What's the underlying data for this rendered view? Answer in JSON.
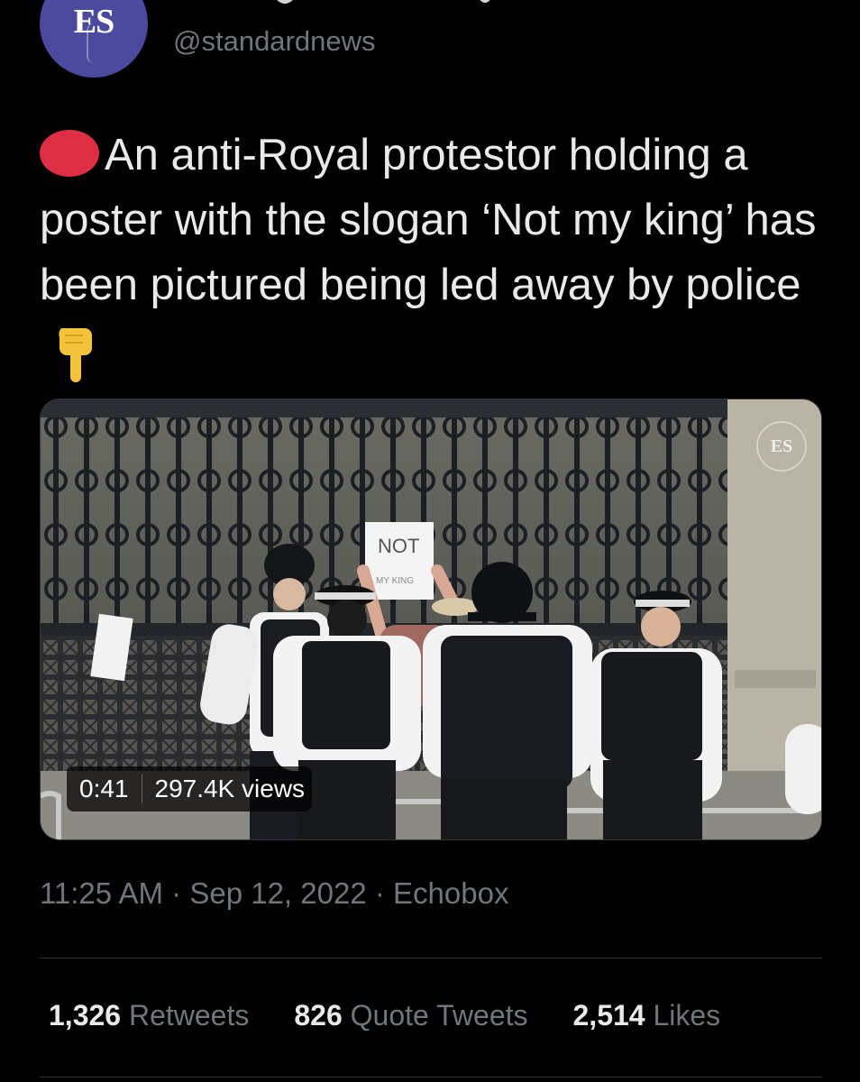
{
  "account": {
    "avatar_text": "ES",
    "handle": "@standardnews"
  },
  "tweet": {
    "text": "An anti-Royal protestor holding a poster with the slogan ‘Not my king’ has been pictured being led away by police",
    "leading_emoji": "red-circle-icon",
    "trailing_emoji": "point-down-icon"
  },
  "media": {
    "type": "video",
    "duration": "0:41",
    "views": "297.4K views",
    "watermark": "ES",
    "sign_text": "NOT",
    "sign_subtext": "MY KING"
  },
  "meta": {
    "time": "11:25 AM",
    "date": "Sep 12, 2022",
    "source": "Echobox",
    "separator": "·"
  },
  "stats": {
    "retweets_count": "1,326",
    "retweets_label": "Retweets",
    "quotes_count": "826",
    "quotes_label": "Quote Tweets",
    "likes_count": "2,514",
    "likes_label": "Likes"
  },
  "colors": {
    "background": "#000000",
    "text": "#e7e9ea",
    "secondary": "#71767b",
    "avatar": "#4b4a9e",
    "red_circle": "#dd2e44",
    "emoji_yellow": "#f5c33b"
  }
}
